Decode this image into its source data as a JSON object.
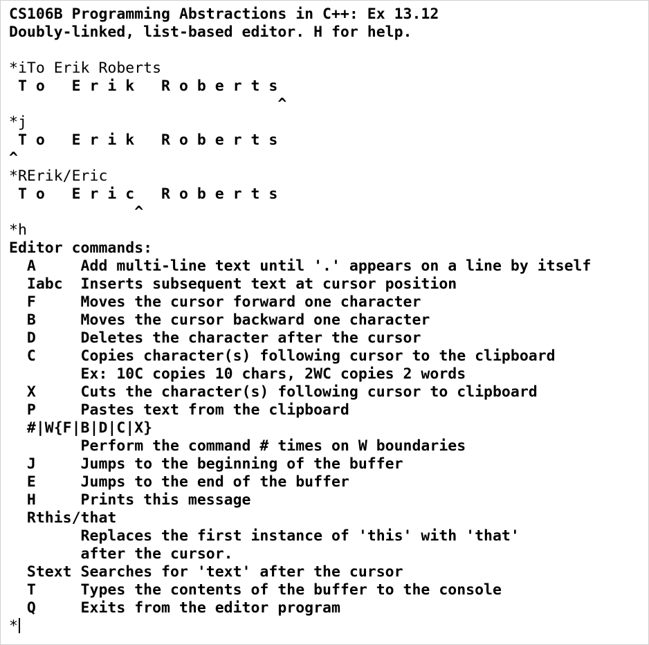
{
  "console": {
    "lines": [
      {
        "text": "CS106B Programming Abstractions in C++: Ex 13.12",
        "style": "b"
      },
      {
        "text": "Doubly-linked, list-based editor. H for help.",
        "style": "b"
      },
      {
        "text": "",
        "style": "b"
      },
      {
        "text": "*iTo Erik Roberts",
        "style": "n"
      },
      {
        "text": " T o   E r i k   R o b e r t s",
        "style": "b"
      },
      {
        "text": "                              ^",
        "style": "b"
      },
      {
        "text": "*j",
        "style": "n"
      },
      {
        "text": " T o   E r i k   R o b e r t s",
        "style": "b"
      },
      {
        "text": "^",
        "style": "b"
      },
      {
        "text": "*RErik/Eric",
        "style": "n"
      },
      {
        "text": " T o   E r i c   R o b e r t s",
        "style": "b"
      },
      {
        "text": "              ^",
        "style": "b"
      },
      {
        "text": "*h",
        "style": "n"
      },
      {
        "text": "Editor commands:",
        "style": "b"
      },
      {
        "text": "  A     Add multi-line text until '.' appears on a line by itself",
        "style": "b"
      },
      {
        "text": "  Iabc  Inserts subsequent text at cursor position",
        "style": "b"
      },
      {
        "text": "  F     Moves the cursor forward one character",
        "style": "b"
      },
      {
        "text": "  B     Moves the cursor backward one character",
        "style": "b"
      },
      {
        "text": "  D     Deletes the character after the cursor",
        "style": "b"
      },
      {
        "text": "  C     Copies character(s) following cursor to the clipboard",
        "style": "b"
      },
      {
        "text": "        Ex: 10C copies 10 chars, 2WC copies 2 words",
        "style": "b"
      },
      {
        "text": "  X     Cuts the character(s) following cursor to clipboard",
        "style": "b"
      },
      {
        "text": "  P     Pastes text from the clipboard",
        "style": "b"
      },
      {
        "text": "  #|W{F|B|D|C|X}",
        "style": "b"
      },
      {
        "text": "        Perform the command # times on W boundaries",
        "style": "b"
      },
      {
        "text": "  J     Jumps to the beginning of the buffer",
        "style": "b"
      },
      {
        "text": "  E     Jumps to the end of the buffer",
        "style": "b"
      },
      {
        "text": "  H     Prints this message",
        "style": "b"
      },
      {
        "text": "  Rthis/that",
        "style": "b"
      },
      {
        "text": "        Replaces the first instance of 'this' with 'that'",
        "style": "b"
      },
      {
        "text": "        after the cursor.",
        "style": "b"
      },
      {
        "text": "  Stext Searches for 'text' after the cursor",
        "style": "b"
      },
      {
        "text": "  T     Types the contents of the buffer to the console",
        "style": "b"
      },
      {
        "text": "  Q     Exits from the editor program",
        "style": "b"
      }
    ],
    "prompt": "*"
  }
}
